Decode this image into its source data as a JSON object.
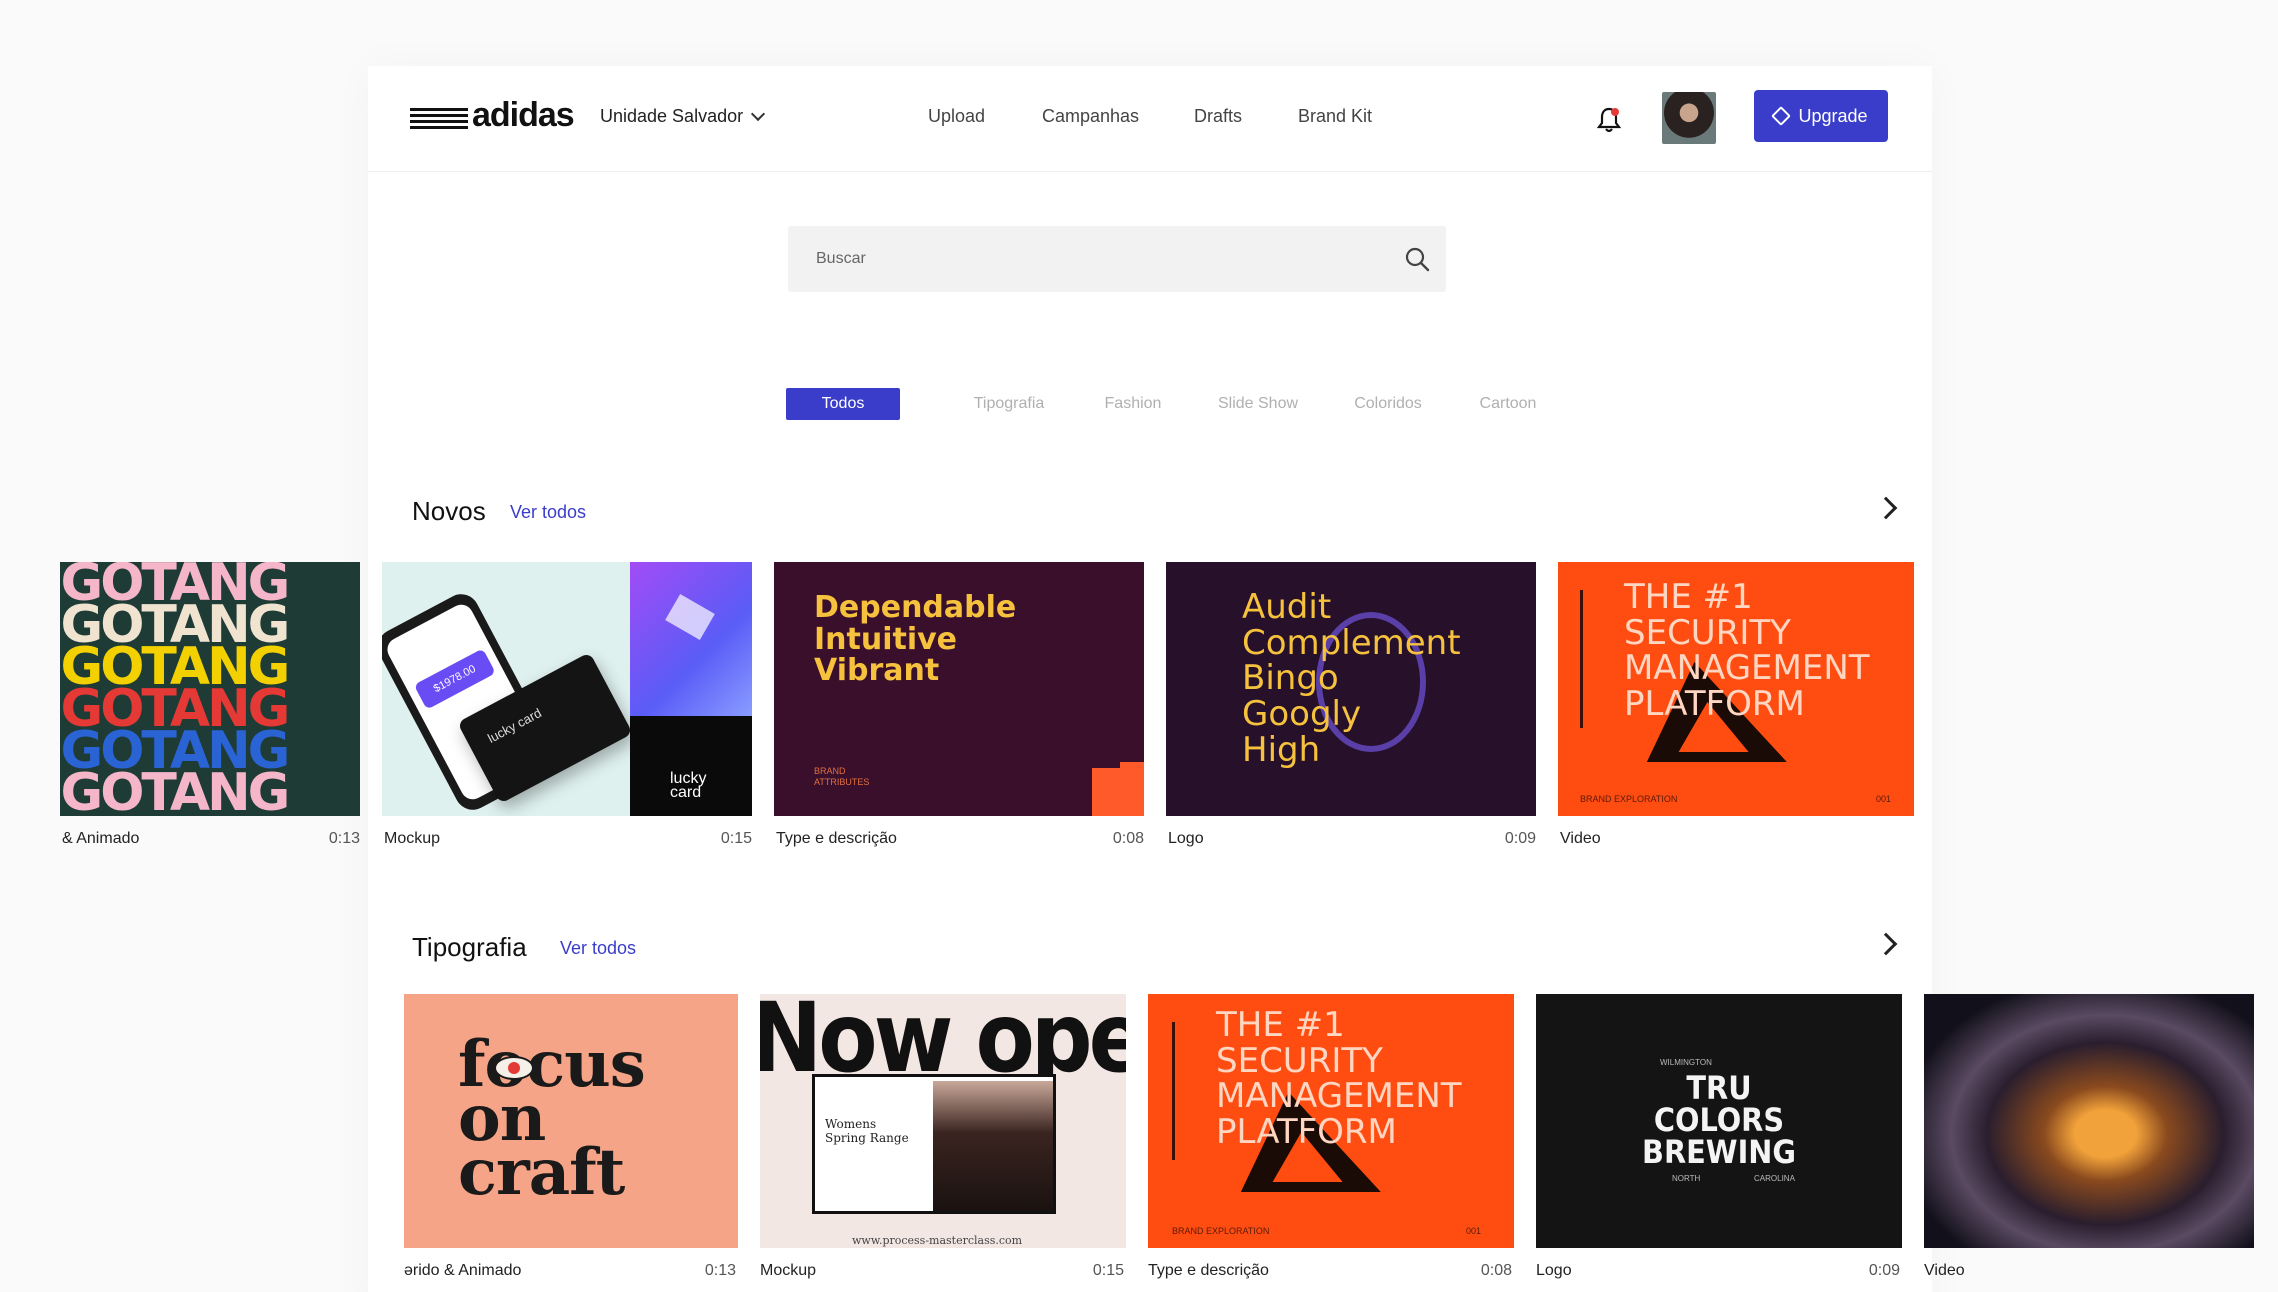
{
  "brand": {
    "name": "adidas",
    "accent": "#3a3dc9"
  },
  "header": {
    "unit_label": "Unidade Salvador",
    "nav": [
      "Upload",
      "Campanhas",
      "Drafts",
      "Brand Kit"
    ],
    "upgrade_label": "Upgrade"
  },
  "search": {
    "placeholder": "Buscar"
  },
  "filters": [
    "Todos",
    "Tipografia",
    "Fashion",
    "Slide Show",
    "Coloridos",
    "Cartoon"
  ],
  "sections": [
    {
      "title": "Novos",
      "link": "Ver todos",
      "cards": [
        {
          "label": "& Animado",
          "duration": "0:13",
          "thumb": "TANGO pattern"
        },
        {
          "label": "Mockup",
          "duration": "0:15",
          "thumb": "lucky card"
        },
        {
          "label": "Type e descrição",
          "duration": "0:08",
          "thumb": "Dependable Intuitive Vibrant"
        },
        {
          "label": "Logo",
          "duration": "0:09",
          "thumb": "Audit Complement Bingo Googly High"
        },
        {
          "label": "Video",
          "duration": "",
          "thumb": "THE #1 SECURITY MANAGEMENT PLATFORM"
        }
      ]
    },
    {
      "title": "Tipografia",
      "link": "Ver todos",
      "cards": [
        {
          "label": "ərido & Animado",
          "duration": "0:13",
          "thumb": "focus on craft"
        },
        {
          "label": "Mockup",
          "duration": "0:15",
          "thumb": "Now open"
        },
        {
          "label": "Type e descrição",
          "duration": "0:08",
          "thumb": "THE #1 SECURITY MANAGEMENT PLATFORM"
        },
        {
          "label": "Logo",
          "duration": "0:09",
          "thumb": "TRU COLORS BREWING"
        },
        {
          "label": "Video",
          "duration": "",
          "thumb": "nebula"
        }
      ]
    }
  ],
  "thumb_texts": {
    "tango": "NGOTANG",
    "lucky": "lucky card",
    "phone_amount": "$1978.00",
    "dependable": [
      "Dependable",
      "Intuitive",
      "Vibrant"
    ],
    "brand_attr": "BRAND ATTRIBUTES",
    "audit": [
      "Audit",
      "Complement",
      "Bingo",
      "Googly",
      "High"
    ],
    "security": [
      "THE #1",
      "SECURITY",
      "MANAGEMENT",
      "PLATFORM"
    ],
    "brand_expl": "BRAND EXPLORATION",
    "num": "001",
    "focus": [
      "focus",
      "on",
      "craft"
    ],
    "nowopen": "Now open",
    "womens": "Womens Spring Range",
    "url": "www.process-masterclass.com",
    "tru": [
      "TRU",
      "COLORS",
      "BREWING"
    ],
    "wilm": "WILMINGTON",
    "north": "NORTH",
    "carolina": "CAROLINA"
  }
}
